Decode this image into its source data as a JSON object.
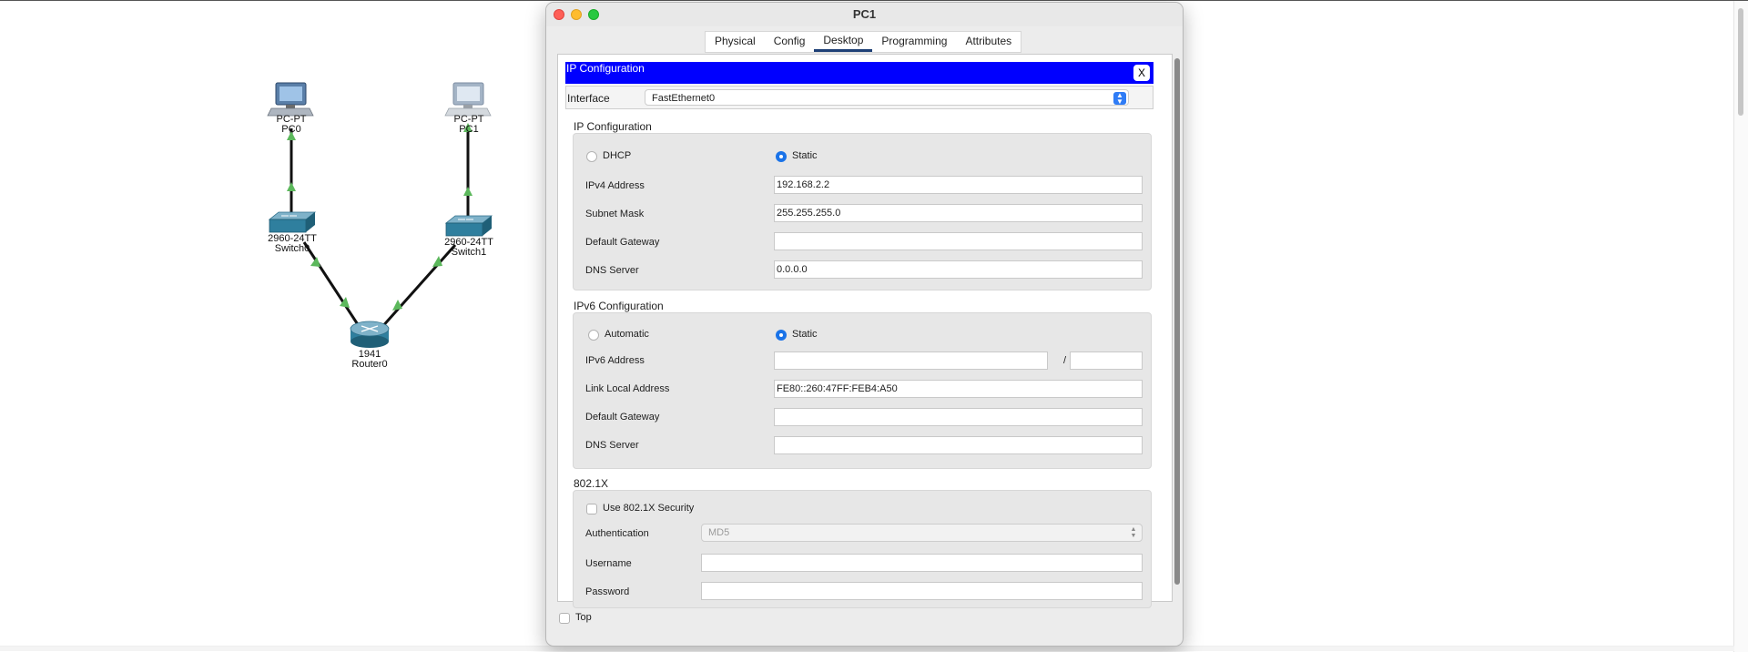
{
  "window": {
    "title": "PC1",
    "tabs": [
      {
        "label": "Physical",
        "active": false
      },
      {
        "label": "Config",
        "active": false
      },
      {
        "label": "Desktop",
        "active": true
      },
      {
        "label": "Programming",
        "active": false
      },
      {
        "label": "Attributes",
        "active": false
      }
    ]
  },
  "ip_config": {
    "header": "IP Configuration",
    "close_label": "X",
    "interface_label": "Interface",
    "interface_value": "FastEthernet0",
    "ipv4": {
      "section_title": "IP Configuration",
      "dhcp_label": "DHCP",
      "static_label": "Static",
      "mode": "Static",
      "address_label": "IPv4 Address",
      "address_value": "192.168.2.2",
      "mask_label": "Subnet Mask",
      "mask_value": "255.255.255.0",
      "gateway_label": "Default Gateway",
      "gateway_value": "",
      "dns_label": "DNS Server",
      "dns_value": "0.0.0.0"
    },
    "ipv6": {
      "section_title": "IPv6 Configuration",
      "auto_label": "Automatic",
      "static_label": "Static",
      "mode": "Static",
      "address_label": "IPv6 Address",
      "address_value": "",
      "slash": "/",
      "prefix_value": "",
      "link_local_label": "Link Local Address",
      "link_local_value": "FE80::260:47FF:FEB4:A50",
      "gateway_label": "Default Gateway",
      "gateway_value": "",
      "dns_label": "DNS Server",
      "dns_value": ""
    },
    "dot1x": {
      "section_title": "802.1X",
      "use_security_label": "Use 802.1X Security",
      "use_security_checked": false,
      "auth_label": "Authentication",
      "auth_value": "MD5",
      "username_label": "Username",
      "username_value": "",
      "password_label": "Password",
      "password_value": ""
    }
  },
  "footer": {
    "top_label": "Top",
    "top_checked": false
  },
  "topology": {
    "devices": [
      {
        "id": "pc0",
        "type_label": "PC-PT",
        "name": "PC0"
      },
      {
        "id": "pc1",
        "type_label": "PC-PT",
        "name": "PC1"
      },
      {
        "id": "switch0",
        "type_label": "2960-24TT",
        "name": "Switch0"
      },
      {
        "id": "switch1",
        "type_label": "2960-24TT",
        "name": "Switch1"
      },
      {
        "id": "router0",
        "type_label": "1941",
        "name": "Router0"
      }
    ],
    "link_status_color": "#5cb85c"
  },
  "colors": {
    "header_blue": "#0000ff",
    "accent": "#1a73e8",
    "tab_underline": "#1d3f76"
  }
}
